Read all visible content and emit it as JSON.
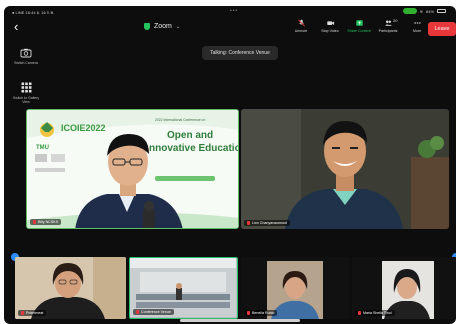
{
  "status_bar": {
    "left": "● LINE 16:44 อ. 16 ก.พ.",
    "dots": "•••",
    "battery": "84%"
  },
  "header": {
    "back_icon": "chevron-left-icon",
    "title": "Zoom",
    "secure_icon": "shield-icon"
  },
  "toolbar": {
    "buttons": [
      {
        "label": "Unmute",
        "icon": "mic-muted-icon"
      },
      {
        "label": "Stop Video",
        "icon": "video-icon"
      },
      {
        "label": "Share Content",
        "icon": "share-icon"
      },
      {
        "label": "Participants",
        "icon": "participants-icon",
        "count": "20"
      },
      {
        "label": "More",
        "icon": "more-icon"
      }
    ],
    "leave_label": "Leave"
  },
  "talking_banner": "Talking: Conference Venue",
  "side_tools": [
    {
      "label": "Switch Camera",
      "icon": "camera-switch-icon"
    },
    {
      "label": "Switch to Gallery View",
      "icon": "gallery-grid-icon"
    }
  ],
  "main_tiles": [
    {
      "name": "Billy NCSKS",
      "slide": {
        "logo": "ICOIE2022",
        "heading_small": "2022 International Conference on",
        "heading_line1": "Open and",
        "heading_line2": "nnovative Education",
        "org": "TMU"
      }
    },
    {
      "name": "Lion Chanyavaonnoot"
    }
  ],
  "participant_strip": [
    {
      "name": "Poemmeat"
    },
    {
      "name": "Conference Venue"
    },
    {
      "name": "Benella Rubio"
    },
    {
      "name": "Maria Sheila Tinol"
    }
  ],
  "colors": {
    "accent_green": "#2bc06a",
    "leave_red": "#e8373b",
    "share_green": "#23c55e",
    "pin_blue": "#2d8cff"
  }
}
